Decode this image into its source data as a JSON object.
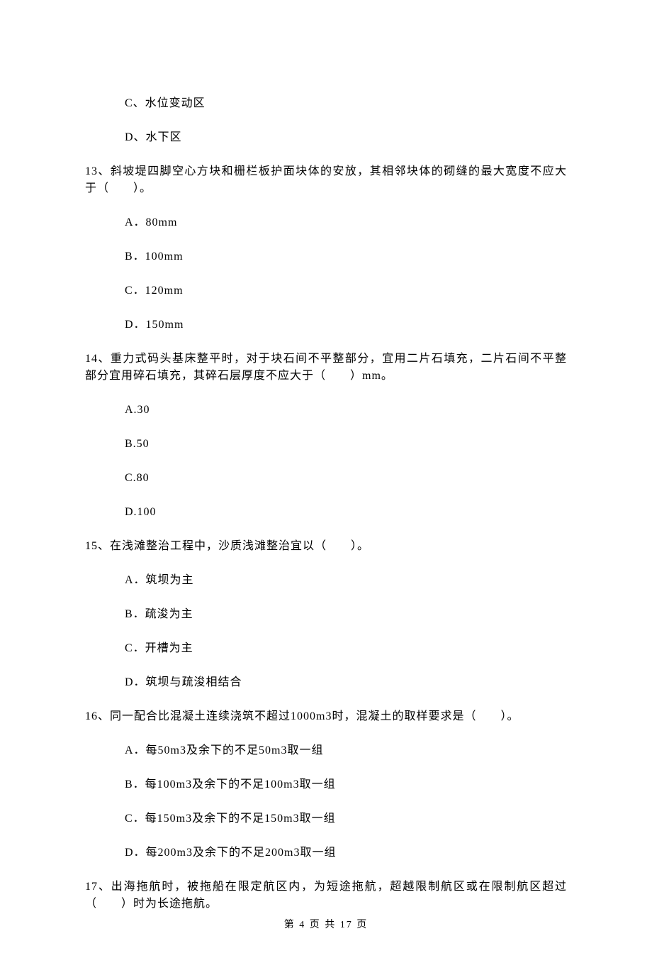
{
  "q12": {
    "optC": "C、水位变动区",
    "optD": "D、水下区"
  },
  "q13": {
    "stem": "13、斜坡堤四脚空心方块和栅栏板护面块体的安放，其相邻块体的砌缝的最大宽度不应大于（　　）。",
    "optA": "A．80mm",
    "optB": "B．100mm",
    "optC": "C．120mm",
    "optD": "D．150mm"
  },
  "q14": {
    "stem": "14、重力式码头基床整平时，对于块石间不平整部分，宜用二片石填充，二片石间不平整部分宜用碎石填充，其碎石层厚度不应大于（　　）mm。",
    "optA": "A.30",
    "optB": "B.50",
    "optC": "C.80",
    "optD": "D.100"
  },
  "q15": {
    "stem": "15、在浅滩整治工程中，沙质浅滩整治宜以（　　）。",
    "optA": "A．筑坝为主",
    "optB": "B．疏浚为主",
    "optC": "C．开槽为主",
    "optD": "D．筑坝与疏浚相结合"
  },
  "q16": {
    "stem": "16、同一配合比混凝土连续浇筑不超过1000m3时，混凝土的取样要求是（　　）。",
    "optA": "A．每50m3及余下的不足50m3取一组",
    "optB": "B．每100m3及余下的不足100m3取一组",
    "optC": "C．每150m3及余下的不足150m3取一组",
    "optD": "D．每200m3及余下的不足200m3取一组"
  },
  "q17": {
    "stem": "17、出海拖航时，被拖船在限定航区内，为短途拖航，超越限制航区或在限制航区超过（　　）时为长途拖航。"
  },
  "footer": "第 4 页 共 17 页"
}
